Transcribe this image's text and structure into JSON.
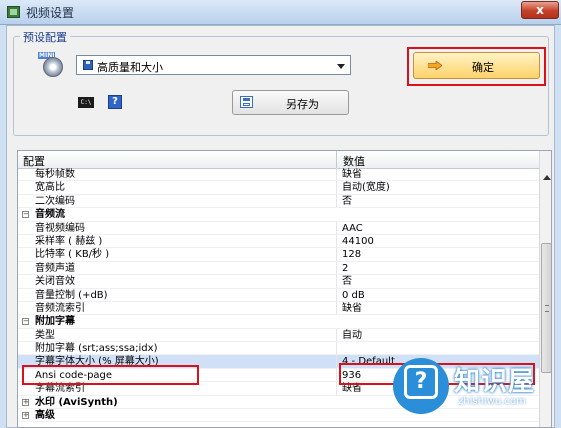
{
  "window": {
    "title": "视频设置",
    "close_label": "x"
  },
  "preset": {
    "group_label": "预设配置",
    "icon_caption": "MINI",
    "selected": "高质量和大小",
    "ok_label": "确定",
    "save_as_label": "另存为",
    "cmd_icon": "C:\\",
    "help_icon": "?"
  },
  "grid": {
    "col_name": "配置",
    "col_value": "数值",
    "rows": [
      {
        "name": "每秒帧数",
        "value": "缺省"
      },
      {
        "name": "宽高比",
        "value": "自动(宽度)"
      },
      {
        "name": "二次编码",
        "value": "否"
      },
      {
        "name": "音频流",
        "value": "",
        "category": true,
        "expanded": true
      },
      {
        "name": "音视频编码",
        "value": "AAC"
      },
      {
        "name": "采样率 ( 赫兹 )",
        "value": "44100"
      },
      {
        "name": "比特率 ( KB/秒 )",
        "value": "128"
      },
      {
        "name": "音频声道",
        "value": "2"
      },
      {
        "name": "关闭音效",
        "value": "否"
      },
      {
        "name": "音量控制 (+dB)",
        "value": "0 dB"
      },
      {
        "name": "音频流索引",
        "value": "缺省"
      },
      {
        "name": "附加字幕",
        "value": "",
        "category": true,
        "expanded": true
      },
      {
        "name": "类型",
        "value": "自动"
      },
      {
        "name": "附加字幕 (srt;ass;ssa;idx)",
        "value": ""
      },
      {
        "name": "字幕字体大小 (% 屏幕大小)",
        "value": "4 - Default",
        "selected": true
      },
      {
        "name": "Ansi code-page",
        "value": "936"
      },
      {
        "name": "字幕流索引",
        "value": "缺省"
      },
      {
        "name": "水印 (AviSynth)",
        "value": "",
        "category": true,
        "expanded": false
      },
      {
        "name": "高级",
        "value": "",
        "category": true,
        "expanded": false
      }
    ]
  },
  "watermark": {
    "brand": "知识屋",
    "domain": "zhishiwu.com"
  },
  "colors": {
    "highlight_red": "#d8121b",
    "accent_blue": "#2a8fd8"
  }
}
